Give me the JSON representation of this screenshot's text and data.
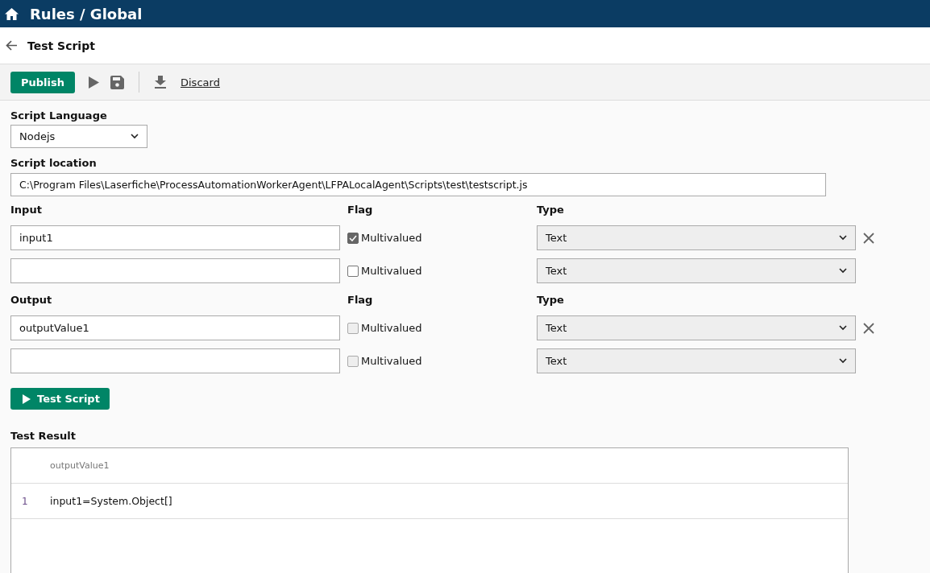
{
  "header": {
    "title": "Rules / Global"
  },
  "page": {
    "title": "Test Script"
  },
  "toolbar": {
    "publish": "Publish",
    "discard": "Discard"
  },
  "script_language": {
    "label": "Script Language",
    "value": "Nodejs"
  },
  "script_location": {
    "label": "Script location",
    "value": "C:\\Program Files\\Laserfiche\\ProcessAutomationWorkerAgent\\LFPALocalAgent\\Scripts\\test\\testscript.js"
  },
  "sections": [
    {
      "name_label": "Input",
      "flag_label": "Flag",
      "type_label": "Type",
      "rows": [
        {
          "name": "input1",
          "flag": "Multivalued",
          "checked": true,
          "disabled": false,
          "type": "Text",
          "removable": true
        },
        {
          "name": "",
          "flag": "Multivalued",
          "checked": false,
          "disabled": false,
          "type": "Text",
          "removable": false
        }
      ]
    },
    {
      "name_label": "Output",
      "flag_label": "Flag",
      "type_label": "Type",
      "rows": [
        {
          "name": "outputValue1",
          "flag": "Multivalued",
          "checked": false,
          "disabled": true,
          "type": "Text",
          "removable": true
        },
        {
          "name": "",
          "flag": "Multivalued",
          "checked": false,
          "disabled": true,
          "type": "Text",
          "removable": false
        }
      ]
    }
  ],
  "test_button": "Test Script",
  "test_result": {
    "label": "Test Result",
    "columns": [
      "outputValue1"
    ],
    "rows": [
      {
        "index": "1",
        "cells": [
          "input1=System.Object[]"
        ]
      }
    ]
  }
}
